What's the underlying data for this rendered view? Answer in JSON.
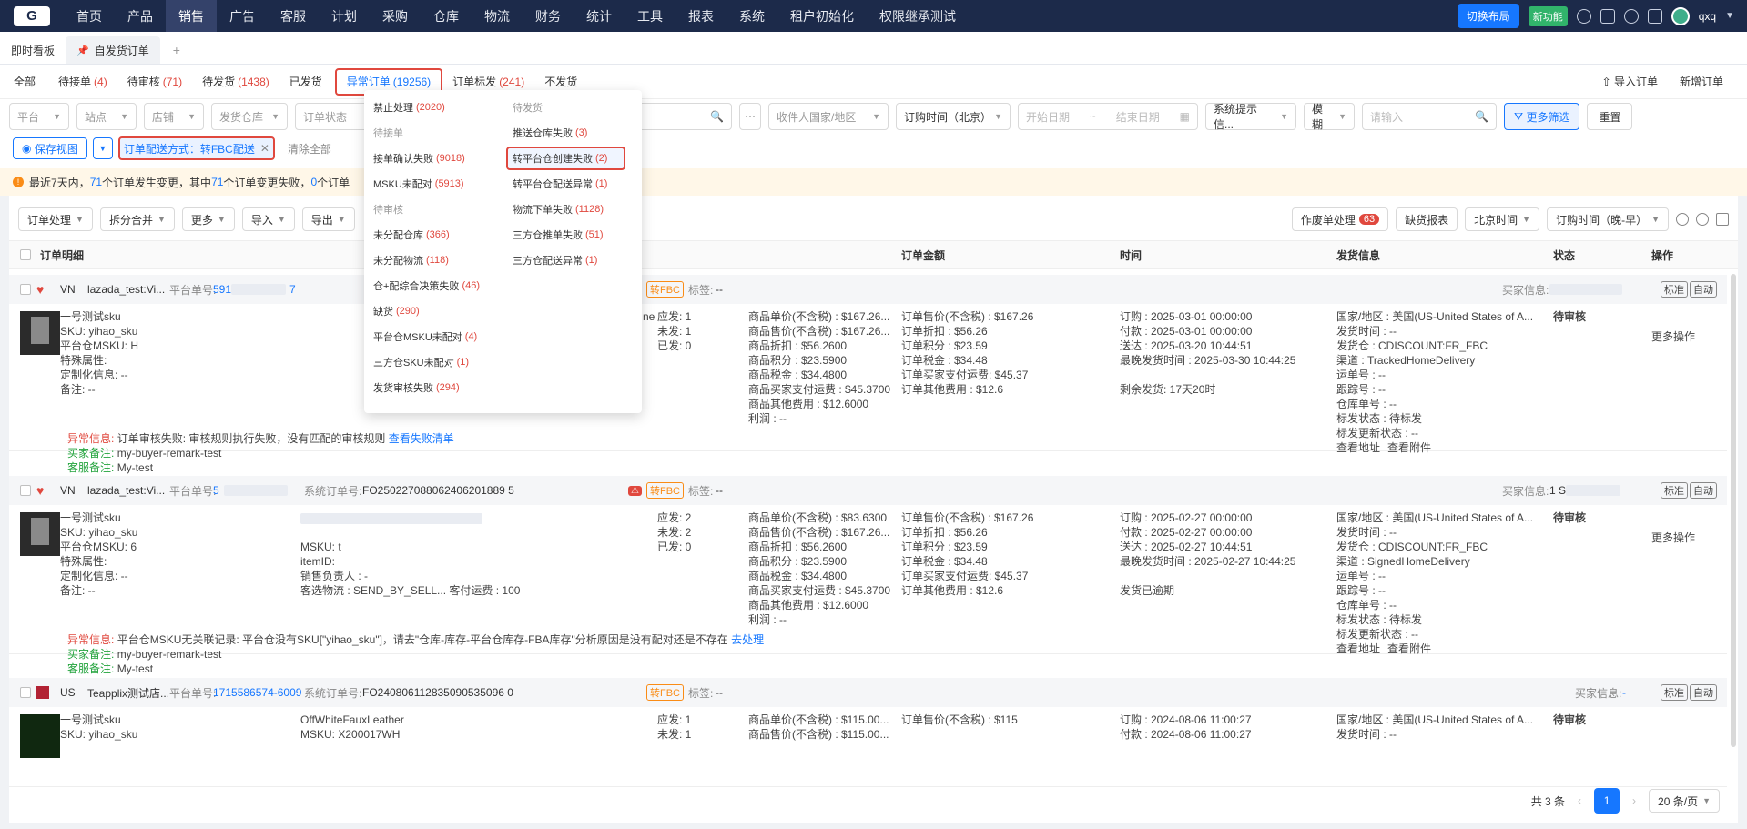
{
  "top_nav": {
    "logo": "G",
    "items": [
      "首页",
      "产品",
      "销售",
      "广告",
      "客服",
      "计划",
      "采购",
      "仓库",
      "物流",
      "财务",
      "统计",
      "工具",
      "报表",
      "系统",
      "租户初始化",
      "权限继承测试"
    ],
    "active_index": 2,
    "switch_layout": "切换布局",
    "new_feature": "新功能",
    "user_badge": "qxq"
  },
  "page_tabs": {
    "items": [
      {
        "label": "即时看板"
      },
      {
        "label": "自发货订单"
      }
    ],
    "active_index": 1
  },
  "status_tabs": [
    {
      "label": "全部",
      "count": ""
    },
    {
      "label": "待接单",
      "count": "(4)"
    },
    {
      "label": "待审核",
      "count": "(71)"
    },
    {
      "label": "待发货",
      "count": "(1438)"
    },
    {
      "label": "已发货",
      "count": ""
    },
    {
      "label": "异常订单",
      "count": "(19256)"
    },
    {
      "label": "订单标发",
      "count": "(241)"
    },
    {
      "label": "不发货",
      "count": ""
    }
  ],
  "status_selected_index": 5,
  "header_actions": {
    "import": "导入订单",
    "new": "新增订单"
  },
  "filters": {
    "platform": "平台",
    "site": "站点",
    "shop": "店铺",
    "warehouse": "发货仓库",
    "order_status": "订单状态",
    "recipient_country": "收件人国家/地区",
    "time_type": "订购时间（北京）",
    "start_date": "开始日期",
    "end_date": "结束日期",
    "system_tip": "系统提示信...",
    "match_mode": "模糊",
    "keyword_placeholder": "请输入",
    "more_filter": "更多筛选",
    "reset": "重置"
  },
  "view": {
    "save_view": "保存视图",
    "active_chip": "订单配送方式：转FBC配送",
    "clear_all": "清除全部"
  },
  "notice": {
    "t1": "最近7天内，",
    "n1": "71",
    "t2": " 个订单发生变更，其中 ",
    "n2": "71",
    "t3": " 个订单变更失败，",
    "n3": "0",
    "t4": " 个订单"
  },
  "toolbar": {
    "buttons": [
      "订单处理",
      "拆分合并",
      "更多",
      "导入",
      "导出"
    ],
    "wasted": "作废单处理",
    "wasted_count": "63",
    "shortage": "缺货报表",
    "timezone": "北京时间",
    "sort": "订购时间（晚-早）"
  },
  "table_headers": {
    "detail": "订单明细",
    "amount": "订单金额",
    "time": "时间",
    "ship": "发货信息",
    "status": "状态",
    "action": "操作"
  },
  "dropdown": {
    "left": [
      {
        "type": "item",
        "label": "禁止处理",
        "count": "(2020)"
      },
      {
        "type": "group",
        "label": "待接单"
      },
      {
        "type": "item",
        "label": "接单确认失败",
        "count": "(9018)"
      },
      {
        "type": "item",
        "label": "MSKU未配对",
        "count": "(5913)"
      },
      {
        "type": "group",
        "label": "待审核"
      },
      {
        "type": "item",
        "label": "未分配仓库",
        "count": "(366)"
      },
      {
        "type": "item",
        "label": "未分配物流",
        "count": "(118)"
      },
      {
        "type": "item",
        "label": "仓+配综合决策失败",
        "count": "(46)"
      },
      {
        "type": "item",
        "label": "缺货",
        "count": "(290)"
      },
      {
        "type": "item",
        "label": "平台仓MSKU未配对",
        "count": "(4)"
      },
      {
        "type": "item",
        "label": "三方仓SKU未配对",
        "count": "(1)"
      },
      {
        "type": "item",
        "label": "发货审核失败",
        "count": "(294)"
      }
    ],
    "right": [
      {
        "type": "group",
        "label": "待发货"
      },
      {
        "type": "item",
        "label": "推送仓库失败",
        "count": "(3)"
      },
      {
        "type": "item",
        "label": "转平台仓创建失败",
        "count": "(2)"
      },
      {
        "type": "item",
        "label": "转平台仓配送异常",
        "count": "(1)"
      },
      {
        "type": "item",
        "label": "物流下单失败",
        "count": "(1128)"
      },
      {
        "type": "item",
        "label": "三方仓推单失败",
        "count": "(51)"
      },
      {
        "type": "item",
        "label": "三方仓配送异常",
        "count": "(1)"
      }
    ]
  },
  "orders": [
    {
      "site": "VN",
      "shop": "lazada_test:Vi...",
      "platform_no_label": "平台单号:",
      "platform_no": "591",
      "platform_no_tail": "7",
      "fbc": "转FBC",
      "tag_label": "标签:",
      "tag": "--",
      "buyer_info_label": "买家信息:",
      "buyer_info": "",
      "product_name": "一号测试sku",
      "sku": "SKU: yihao_sku",
      "msku": "平台仓MSKU: H",
      "special": "特殊属性:",
      "custom": "定制化信息: --",
      "remark": "备注: --",
      "title_tail": "ne",
      "qty": {
        "should": "应发: 1",
        "unsent": "未发: 1",
        "sent": "已发: 0"
      },
      "prices": [
        "商品单价(不含税) : $167.26...",
        "商品售价(不含税) : $167.26...",
        "商品折扣 : $56.2600",
        "商品积分 : $23.5900",
        "商品税金 : $34.4800",
        "商品买家支付运费 : $45.3700",
        "商品其他费用 : $12.6000",
        "利润 : --"
      ],
      "amounts": [
        "订单售价(不含税) : $167.26",
        "订单折扣 : $56.26",
        "订单积分 : $23.59",
        "订单税金 : $34.48",
        "订单买家支付运费: $45.37",
        "订单其他费用 : $12.6"
      ],
      "times": [
        "订购 : 2025-03-01 00:00:00",
        "付款 : 2025-03-01 00:00:00",
        "送达 : 2025-03-20 10:44:51",
        "最晚发货时间 : 2025-03-30 10:44:25"
      ],
      "time_alert": "剩余发货: 17天20时",
      "ship": [
        "国家/地区 : 美国(US-United States of A...",
        "发货时间 : --",
        "发货仓 : CDISCOUNT:FR_FBC",
        "渠道 : TrackedHomeDelivery",
        "运单号 : --",
        "跟踪号 : --",
        "仓库单号 : --",
        "标发状态 : 待标发",
        "标发更新状态 : --"
      ],
      "ship_links": [
        "查看地址",
        "查看附件"
      ],
      "status": "待审核",
      "more_ops": "更多操作",
      "exception_label": "异常信息:",
      "exception": "订单审核失败: 审核规则执行失败，没有匹配的审核规则",
      "exception_link": "查看失败清单",
      "buyer_remark_label": "买家备注:",
      "buyer_remark": "my-buyer-remark-test",
      "cs_remark_label": "客服备注:",
      "cs_remark": "My-test",
      "btn_mark": "标准",
      "btn_auto": "自动"
    },
    {
      "site": "VN",
      "shop": "lazada_test:Vi...",
      "platform_no_label": "平台单号:",
      "platform_no": "5",
      "platform_no_tail": "",
      "system_no_label": "系统订单号:",
      "system_no": "FO250227088062406201889 5",
      "fbc": "转FBC",
      "tag_label": "标签:",
      "tag": "--",
      "buyer_info_label": "买家信息:",
      "buyer_info": "1 S",
      "product_name": "一号测试sku",
      "sku": "SKU: yihao_sku",
      "msku": "平台仓MSKU: 6",
      "special": "特殊属性:",
      "custom": "定制化信息: --",
      "remark": "备注: --",
      "detail": [
        "MSKU: t",
        "itemID:",
        "销售负责人 : -",
        "客选物流 : SEND_BY_SELL...    客付运费 : 100"
      ],
      "qty": {
        "should": "应发: 2",
        "unsent": "未发: 2",
        "sent": "已发: 0"
      },
      "prices": [
        "商品单价(不含税) : $83.6300",
        "商品售价(不含税) : $167.26...",
        "商品折扣 : $56.2600",
        "商品积分 : $23.5900",
        "商品税金 : $34.4800",
        "商品买家支付运费 : $45.3700",
        "商品其他费用 : $12.6000",
        "利润 : --"
      ],
      "amounts": [
        "订单售价(不含税) : $167.26",
        "订单折扣 : $56.26",
        "订单积分 : $23.59",
        "订单税金 : $34.48",
        "订单买家支付运费: $45.37",
        "订单其他费用 : $12.6"
      ],
      "times": [
        "订购 : 2025-02-27 00:00:00",
        "付款 : 2025-02-27 00:00:00",
        "送达 : 2025-02-27 10:44:51",
        "最晚发货时间 : 2025-02-27 10:44:25"
      ],
      "time_alert": "发货已逾期",
      "ship": [
        "国家/地区 : 美国(US-United States of A...",
        "发货时间 : --",
        "发货仓 : CDISCOUNT:FR_FBC",
        "渠道 : SignedHomeDelivery",
        "运单号 : --",
        "跟踪号 : --",
        "仓库单号 : --",
        "标发状态 : 待标发",
        "标发更新状态 : --"
      ],
      "ship_links": [
        "查看地址",
        "查看附件"
      ],
      "status": "待审核",
      "more_ops": "更多操作",
      "exception_label": "异常信息:",
      "exception": "平台仓MSKU无关联记录: 平台仓没有SKU[\"yihao_sku\"]，请去\"仓库-库存-平台仓库存-FBA库存\"分析原因是没有配对还是不存在",
      "exception_link": "去处理",
      "buyer_remark_label": "买家备注:",
      "buyer_remark": "my-buyer-remark-test",
      "cs_remark_label": "客服备注:",
      "cs_remark": "My-test",
      "btn_mark": "标准",
      "btn_auto": "自动"
    },
    {
      "site": "US",
      "shop": "Teapplix测试店...",
      "platform_no_label": "平台单号:",
      "platform_no": "1715586574-6009",
      "system_no_label": "系统订单号:",
      "system_no": "FO240806112835090535096 0",
      "fbc": "转FBC",
      "tag_label": "标签:",
      "tag": "--",
      "buyer_info_label": "买家信息:",
      "buyer_info": "-",
      "product_name": "一号测试sku",
      "sku": "SKU: yihao_sku",
      "title": "OffWhiteFauxLeather",
      "msku_line": "MSKU: X200017WH",
      "qty": {
        "should": "应发: 1",
        "unsent": "未发: 1"
      },
      "prices": [
        "商品单价(不含税) : $115.00...",
        "商品售价(不含税) : $115.00..."
      ],
      "amounts": [
        "订单售价(不含税) : $115"
      ],
      "times": [
        "订购 : 2024-08-06 11:00:27",
        "付款 : 2024-08-06 11:00:27"
      ],
      "ship": [
        "国家/地区 : 美国(US-United States of A...",
        "发货时间 : --"
      ],
      "status": "待审核",
      "btn_mark": "标准",
      "btn_auto": "自动"
    }
  ],
  "pager": {
    "total": "共 3 条",
    "current": "1",
    "page_size": "20 条/页"
  }
}
